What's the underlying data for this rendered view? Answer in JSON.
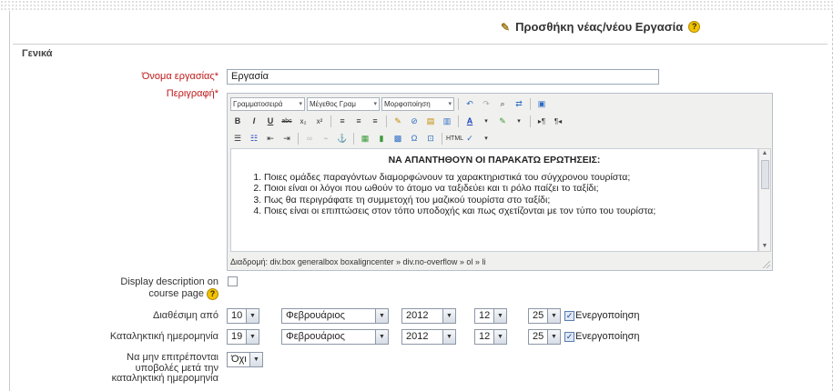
{
  "page_title": "Προσθήκη νέας/νέου Εργασία",
  "section_general": "Γενικά",
  "fields": {
    "name_label": "Όνομα εργασίας",
    "name_value": "Εργασία",
    "description_label": "Περιγραφή",
    "required_mark": "*",
    "display_desc_label_1": "Display description on",
    "display_desc_label_2": "course page",
    "available_from_label": "Διαθέσιμη από",
    "due_date_label": "Καταληκτική ημερομηνία",
    "prevent_late_label_1": "Να μην επιτρέπονται",
    "prevent_late_label_2": "υποβολές μετά την",
    "prevent_late_label_3": "καταληκτική ημερομηνία",
    "prevent_late_value": "Όχι"
  },
  "editor": {
    "font_family_select": "Γραμματοσειρά",
    "font_size_select": "Μέγεθος Γραμ",
    "format_select": "Μορφοποίηση",
    "heading": "ΝΑ ΑΠΑΝΤΗΘΟΥΝ ΟΙ ΠΑΡΑΚΑΤΩ ΕΡΩΤΗΣΕΙΣ:",
    "questions": [
      "Ποιες ομάδες παραγόντων διαμορφώνουν τα χαρακτηριστικά του σύγχρονου τουρίστα;",
      "Ποιοι είναι οι λόγοι που ωθούν το άτομο να ταξιδεύει και τι ρόλο παίζει το ταξίδι;",
      "Πως θα περιγράφατε τη συμμετοχή του μαζικού τουρίστα στο ταξίδι;",
      "Ποιες είναι οι επιπτώσεις στον τόπο υποδοχής και πως σχετίζονται με τον τύπο του τουρίστα;"
    ],
    "path": "Διαδρομή: div.box generalbox boxaligncenter » div.no-overflow » ol » li"
  },
  "available_from": {
    "day": "10",
    "month": "Φεβρουάριος",
    "year": "2012",
    "hour": "12",
    "minute": "25",
    "enable_label": "Ενεργοποίηση"
  },
  "due_date": {
    "day": "19",
    "month": "Φεβρουάριος",
    "year": "2012",
    "hour": "12",
    "minute": "25",
    "enable_label": "Ενεργοποίηση"
  }
}
